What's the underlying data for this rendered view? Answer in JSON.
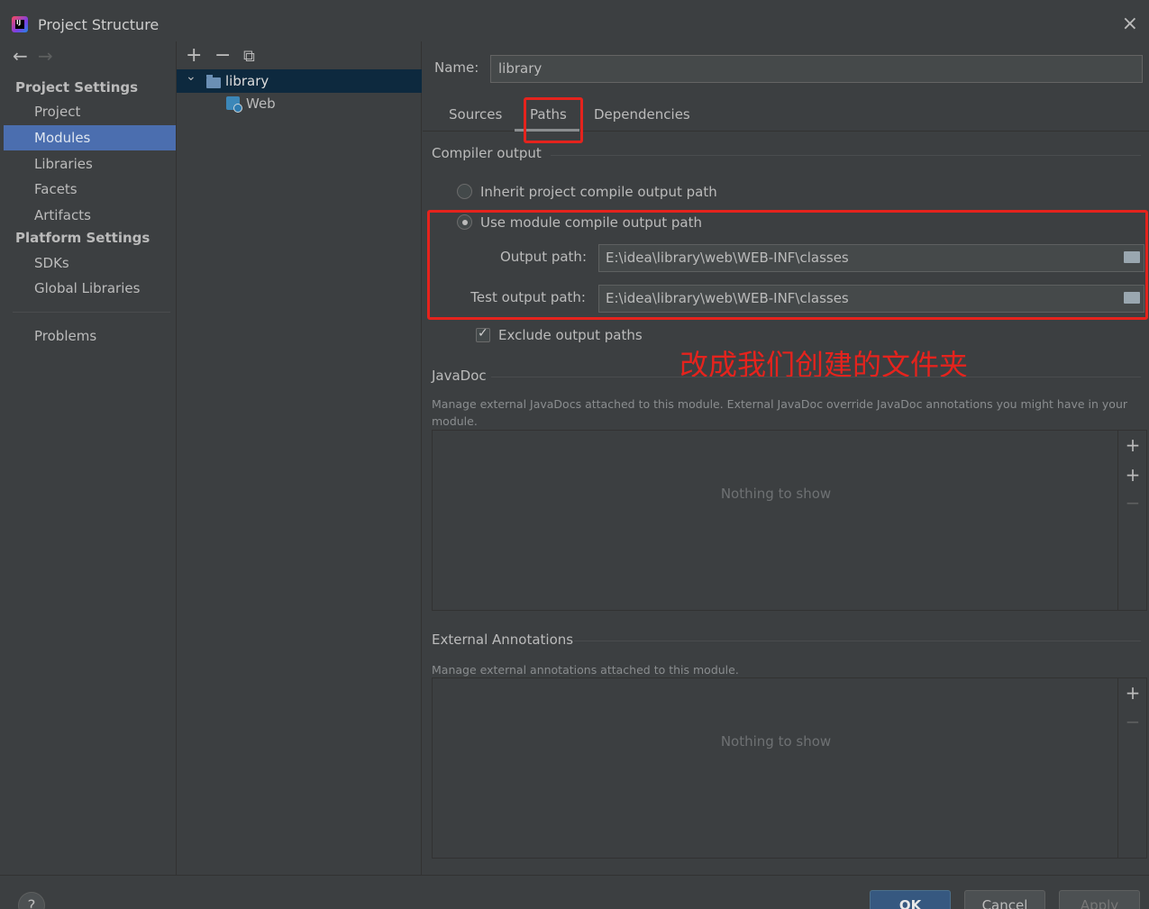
{
  "window": {
    "title": "Project Structure",
    "close_glyph": "×"
  },
  "nav": {
    "back": "←",
    "forward": "→"
  },
  "sidebar": {
    "section1": "Project Settings",
    "items1": [
      "Project",
      "Modules",
      "Libraries",
      "Facets",
      "Artifacts"
    ],
    "section2": "Platform Settings",
    "items2": [
      "SDKs",
      "Global Libraries"
    ],
    "problems": "Problems",
    "active": "Modules"
  },
  "tree": {
    "tools": {
      "add": "+",
      "remove": "−",
      "copy": "⧉"
    },
    "nodes": [
      {
        "label": "library",
        "expander": "⌄",
        "selected": true
      },
      {
        "label": "Web",
        "selected": false
      }
    ]
  },
  "module": {
    "name_label": "Name:",
    "name_value": "library",
    "tabs": [
      "Sources",
      "Paths",
      "Dependencies"
    ],
    "active_tab": "Paths"
  },
  "compiler": {
    "title": "Compiler output",
    "inherit_label": "Inherit project compile output path",
    "use_module_label": "Use module compile output path",
    "selected": "use_module",
    "output_label": "Output path:",
    "output_value": "E:\\idea\\library\\web\\WEB-INF\\classes",
    "test_label": "Test output path:",
    "test_value": "E:\\idea\\library\\web\\WEB-INF\\classes",
    "exclude_label": "Exclude output paths",
    "exclude_checked": true
  },
  "annotation_text": "改成我们创建的文件夹",
  "javadoc": {
    "title": "JavaDoc",
    "hint": "Manage external JavaDocs attached to this module. External JavaDoc override JavaDoc annotations you might have in your module.",
    "empty": "Nothing to show",
    "tools": {
      "add": "+",
      "add_url": "+",
      "remove": "−"
    }
  },
  "external_annotations": {
    "title": "External Annotations",
    "hint": "Manage external annotations attached to this module.",
    "empty": "Nothing to show",
    "tools": {
      "add": "+",
      "remove": "−"
    }
  },
  "footer": {
    "help": "?",
    "ok": "OK",
    "cancel": "Cancel",
    "apply": "Apply"
  },
  "colors": {
    "background": "#3c3f41",
    "selection": "#4b6eaf",
    "tree_selection": "#0d293e",
    "annotation": "#e5231d",
    "primary_button": "#365880"
  }
}
